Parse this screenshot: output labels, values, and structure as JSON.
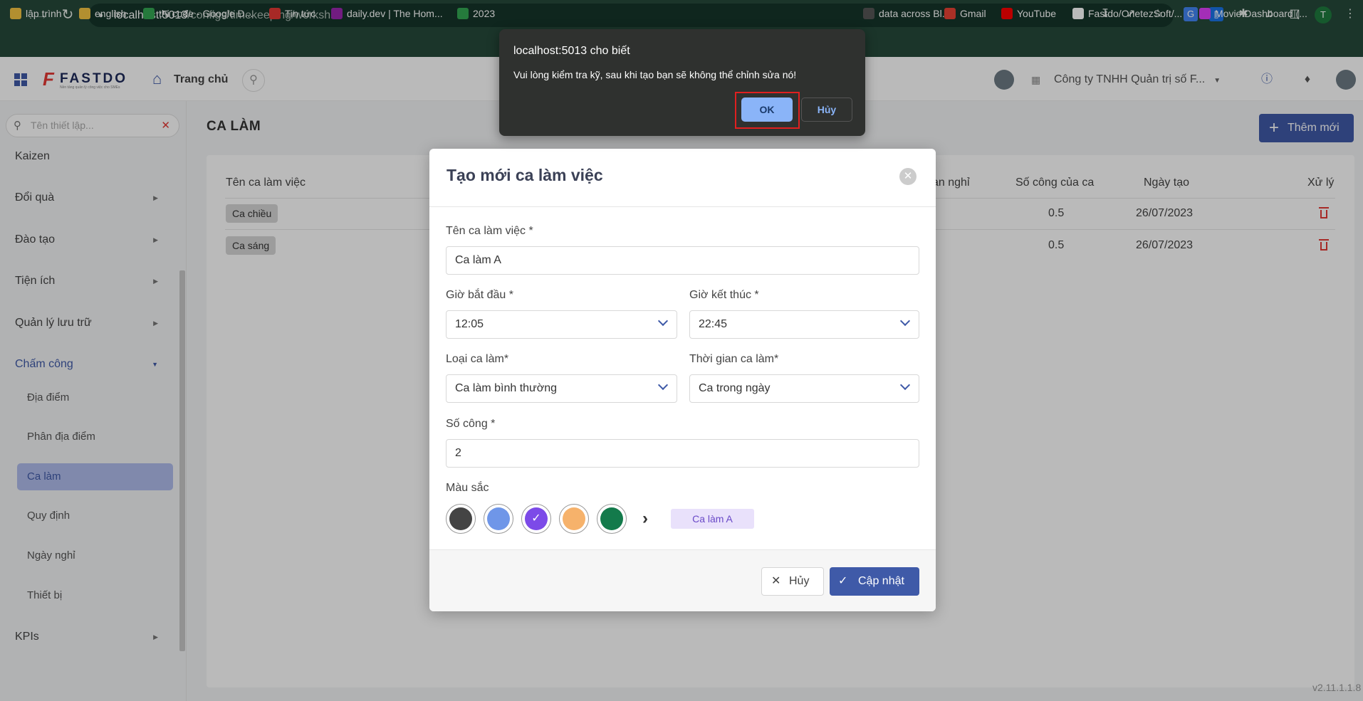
{
  "browser": {
    "url_host": "localhost:5013",
    "url_path": "/configs/timekeeping/workshift",
    "bookmarks": [
      {
        "label": "lập trình",
        "color": "#f5c542"
      },
      {
        "label": "english",
        "color": "#f5c542"
      },
      {
        "label": "thi cođe - Google D...",
        "color": "#34a853"
      },
      {
        "label": "Tin tức",
        "color": "#e53935"
      },
      {
        "label": "daily.dev | The Hom...",
        "color": "#9c27b0"
      },
      {
        "label": "2023",
        "color": "#34a853"
      },
      {
        "label": "data across Bl...",
        "color": "#555555"
      },
      {
        "label": "Gmail",
        "color": "#ea4335"
      },
      {
        "label": "YouTube",
        "color": "#ff0000"
      },
      {
        "label": "Fastdo/OnetezSoft/...",
        "color": "#ffffff"
      },
      {
        "label": "Movie Dashboard (...",
        "color": "#e040fb"
      }
    ],
    "profile_initial": "T"
  },
  "app": {
    "logo_text": "FASTDO",
    "logo_tagline": "Nền tảng quản lý công việc cho SMEs",
    "home_label": "Trang chủ",
    "company_name": "Công ty TNHH Quản trị số F...",
    "accent_color": "#3f5aa8"
  },
  "sidebar": {
    "search_placeholder": "Tên thiết lập...",
    "items": [
      {
        "label": "Kaizen"
      },
      {
        "label": "Đổi quà"
      },
      {
        "label": "Đào tạo"
      },
      {
        "label": "Tiện ích"
      },
      {
        "label": "Quản lý lưu trữ"
      },
      {
        "label": "Chấm công"
      },
      {
        "label": "KPIs"
      }
    ],
    "sub_items": [
      {
        "label": "Địa điểm"
      },
      {
        "label": "Phân địa điểm"
      },
      {
        "label": "Ca làm"
      },
      {
        "label": "Quy định"
      },
      {
        "label": "Ngày nghỉ"
      },
      {
        "label": "Thiết bị"
      }
    ]
  },
  "page": {
    "title": "CA LÀM",
    "add_button": "Thêm mới",
    "columns": [
      "Tên ca làm việc",
      "an nghỉ",
      "Số công của ca",
      "Ngày tạo",
      "Xử lý"
    ],
    "rows": [
      {
        "name": "Ca chiều",
        "workdays": "0.5",
        "created": "26/07/2023"
      },
      {
        "name": "Ca sáng",
        "workdays": "0.5",
        "created": "26/07/2023"
      }
    ],
    "version": "v2.11.1.1.8"
  },
  "modal": {
    "title": "Tạo mới ca làm việc",
    "name_label": "Tên ca làm việc *",
    "name_value": "Ca làm A",
    "start_label": "Giờ bắt đầu *",
    "start_value": "12:05",
    "end_label": "Giờ kết thúc *",
    "end_value": "22:45",
    "type_label": "Loại ca làm*",
    "type_value": "Ca làm bình thường",
    "time_label": "Thời gian ca làm*",
    "time_value": "Ca trong ngày",
    "workdays_label": "Số công *",
    "workdays_value": "2",
    "color_label": "Màu sắc",
    "colors": [
      "#444444",
      "#6f96e8",
      "#7c4ae8",
      "#f6b26b",
      "#137a4b"
    ],
    "selected_color": "#7c4ae8",
    "preview_text": "Ca làm A",
    "cancel_label": "Hủy",
    "save_label": "Cập nhật"
  },
  "alert": {
    "title": "localhost:5013 cho biết",
    "message": "Vui lòng kiểm tra kỹ, sau khi tạo bạn sẽ không thể chỉnh sửa nó!",
    "ok_label": "OK",
    "cancel_label": "Hủy"
  }
}
